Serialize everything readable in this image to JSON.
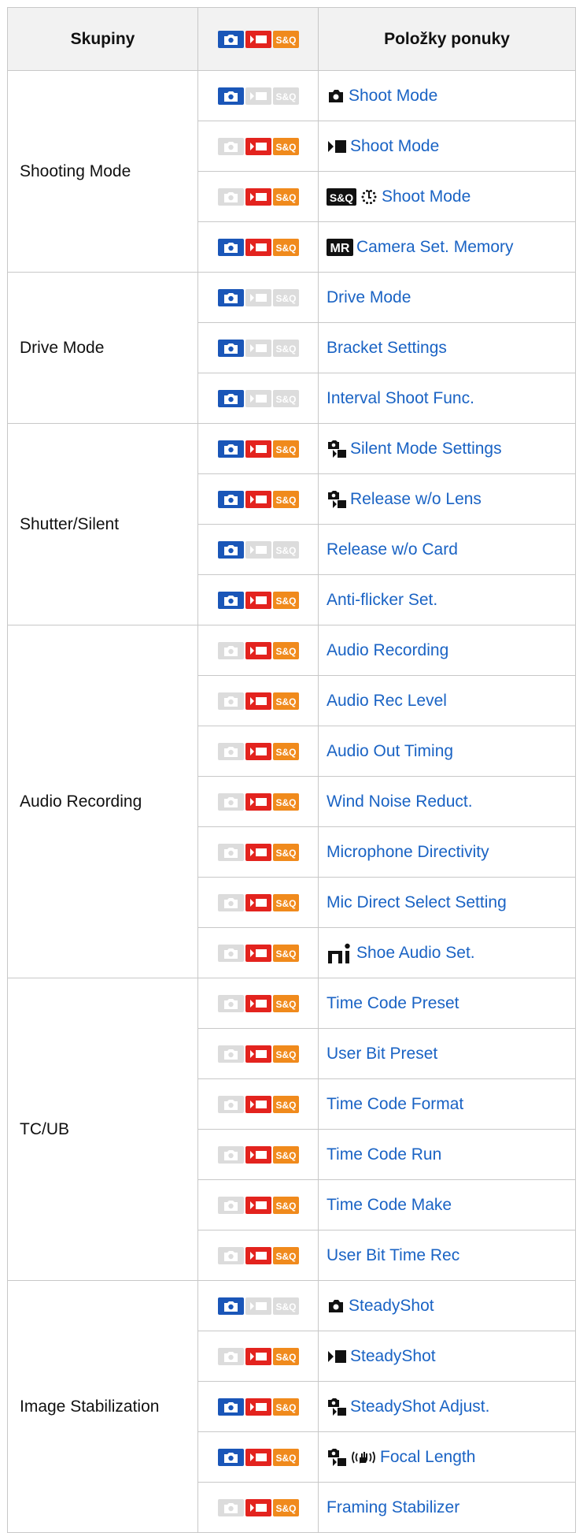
{
  "header": {
    "groups_label": "Skupiny",
    "items_label": "Položky ponuky",
    "mode_s_and_q": "S&Q"
  },
  "colors": {
    "photo": "#1a56b8",
    "movie": "#e3231e",
    "sq": "#f08a1c",
    "inactive": "#dcdcdc",
    "link": "#1a63c4"
  },
  "groups": [
    {
      "name": "Shooting Mode",
      "rows": [
        {
          "modes": [
            true,
            false,
            false
          ],
          "icons": [
            "photo-mode-icon"
          ],
          "label": "Shoot Mode"
        },
        {
          "modes": [
            false,
            true,
            true
          ],
          "icons": [
            "movie-mode-icon"
          ],
          "label": "Shoot Mode"
        },
        {
          "modes": [
            false,
            true,
            true
          ],
          "icons": [
            "sq-badge-icon",
            "dial-icon"
          ],
          "badge": "S&Q",
          "label": "Shoot Mode"
        },
        {
          "modes": [
            true,
            true,
            true
          ],
          "icons": [
            "mr-badge-icon"
          ],
          "badge": "MR",
          "label": "Camera Set. Memory"
        }
      ]
    },
    {
      "name": "Drive Mode",
      "rows": [
        {
          "modes": [
            true,
            false,
            false
          ],
          "icons": [],
          "label": "Drive Mode"
        },
        {
          "modes": [
            true,
            false,
            false
          ],
          "icons": [],
          "label": "Bracket Settings"
        },
        {
          "modes": [
            true,
            false,
            false
          ],
          "icons": [],
          "label": "Interval Shoot Func."
        }
      ]
    },
    {
      "name": "Shutter/Silent",
      "rows": [
        {
          "modes": [
            true,
            true,
            true
          ],
          "icons": [
            "photo-movie-icon"
          ],
          "label": "Silent Mode Settings"
        },
        {
          "modes": [
            true,
            true,
            true
          ],
          "icons": [
            "photo-movie-icon"
          ],
          "label": "Release w/o Lens"
        },
        {
          "modes": [
            true,
            false,
            false
          ],
          "icons": [],
          "label": "Release w/o Card"
        },
        {
          "modes": [
            true,
            true,
            true
          ],
          "icons": [],
          "label": "Anti-flicker Set."
        }
      ]
    },
    {
      "name": "Audio Recording",
      "rows": [
        {
          "modes": [
            false,
            true,
            true
          ],
          "icons": [],
          "label": "Audio Recording"
        },
        {
          "modes": [
            false,
            true,
            true
          ],
          "icons": [],
          "label": "Audio Rec Level"
        },
        {
          "modes": [
            false,
            true,
            true
          ],
          "icons": [],
          "label": "Audio Out Timing"
        },
        {
          "modes": [
            false,
            true,
            true
          ],
          "icons": [],
          "label": "Wind Noise Reduct."
        },
        {
          "modes": [
            false,
            true,
            true
          ],
          "icons": [],
          "label": "Microphone Directivity"
        },
        {
          "modes": [
            false,
            true,
            true
          ],
          "icons": [],
          "label": "Mic Direct Select Setting"
        },
        {
          "modes": [
            false,
            true,
            true
          ],
          "icons": [
            "multi-interface-shoe-icon"
          ],
          "label": "Shoe Audio Set."
        }
      ]
    },
    {
      "name": "TC/UB",
      "rows": [
        {
          "modes": [
            false,
            true,
            true
          ],
          "icons": [],
          "label": "Time Code Preset"
        },
        {
          "modes": [
            false,
            true,
            true
          ],
          "icons": [],
          "label": "User Bit Preset"
        },
        {
          "modes": [
            false,
            true,
            true
          ],
          "icons": [],
          "label": "Time Code Format"
        },
        {
          "modes": [
            false,
            true,
            true
          ],
          "icons": [],
          "label": "Time Code Run"
        },
        {
          "modes": [
            false,
            true,
            true
          ],
          "icons": [],
          "label": "Time Code Make"
        },
        {
          "modes": [
            false,
            true,
            true
          ],
          "icons": [],
          "label": "User Bit Time Rec"
        }
      ]
    },
    {
      "name": "Image Stabilization",
      "rows": [
        {
          "modes": [
            true,
            false,
            false
          ],
          "icons": [
            "photo-mode-icon"
          ],
          "label": "SteadyShot"
        },
        {
          "modes": [
            false,
            true,
            true
          ],
          "icons": [
            "movie-mode-icon"
          ],
          "label": "SteadyShot"
        },
        {
          "modes": [
            true,
            true,
            true
          ],
          "icons": [
            "photo-movie-icon"
          ],
          "label": "SteadyShot Adjust."
        },
        {
          "modes": [
            true,
            true,
            true
          ],
          "icons": [
            "photo-movie-icon",
            "shake-hand-icon"
          ],
          "label": "Focal Length"
        },
        {
          "modes": [
            false,
            true,
            true
          ],
          "icons": [],
          "label": "Framing Stabilizer"
        }
      ]
    }
  ]
}
